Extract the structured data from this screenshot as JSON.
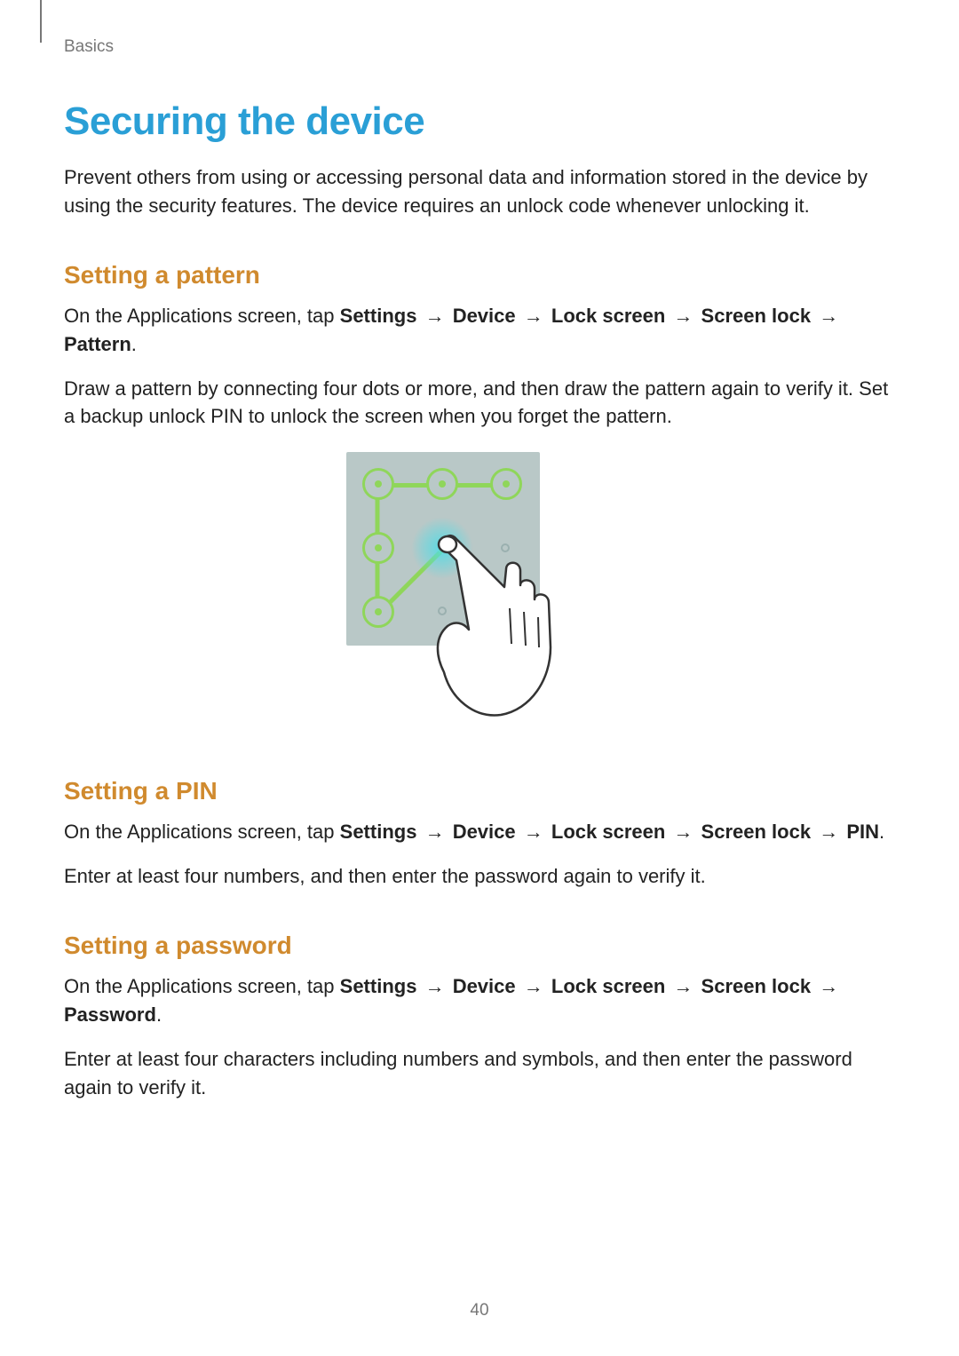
{
  "breadcrumb": "Basics",
  "title": "Securing the device",
  "intro": "Prevent others from using or accessing personal data and information stored in the device by using the security features. The device requires an unlock code whenever unlocking it.",
  "arrow": "→",
  "sections": {
    "pattern": {
      "heading": "Setting a pattern",
      "path_prefix": "On the Applications screen, tap ",
      "nav": {
        "s": "Settings",
        "d": "Device",
        "l": "Lock screen",
        "sl": "Screen lock",
        "final": "Pattern"
      },
      "period": ".",
      "body2": "Draw a pattern by connecting four dots or more, and then draw the pattern again to verify it. Set a backup unlock PIN to unlock the screen when you forget the pattern."
    },
    "pin": {
      "heading": "Setting a PIN",
      "path_prefix": "On the Applications screen, tap ",
      "nav": {
        "s": "Settings",
        "d": "Device",
        "l": "Lock screen",
        "sl": "Screen lock",
        "final": "PIN"
      },
      "period": ".",
      "body2": "Enter at least four numbers, and then enter the password again to verify it."
    },
    "password": {
      "heading": "Setting a password",
      "path_prefix": "On the Applications screen, tap ",
      "nav": {
        "s": "Settings",
        "d": "Device",
        "l": "Lock screen",
        "sl": "Screen lock",
        "final": "Password"
      },
      "period": ".",
      "body2": "Enter at least four characters including numbers and symbols, and then enter the password again to verify it."
    }
  },
  "page_number": "40"
}
